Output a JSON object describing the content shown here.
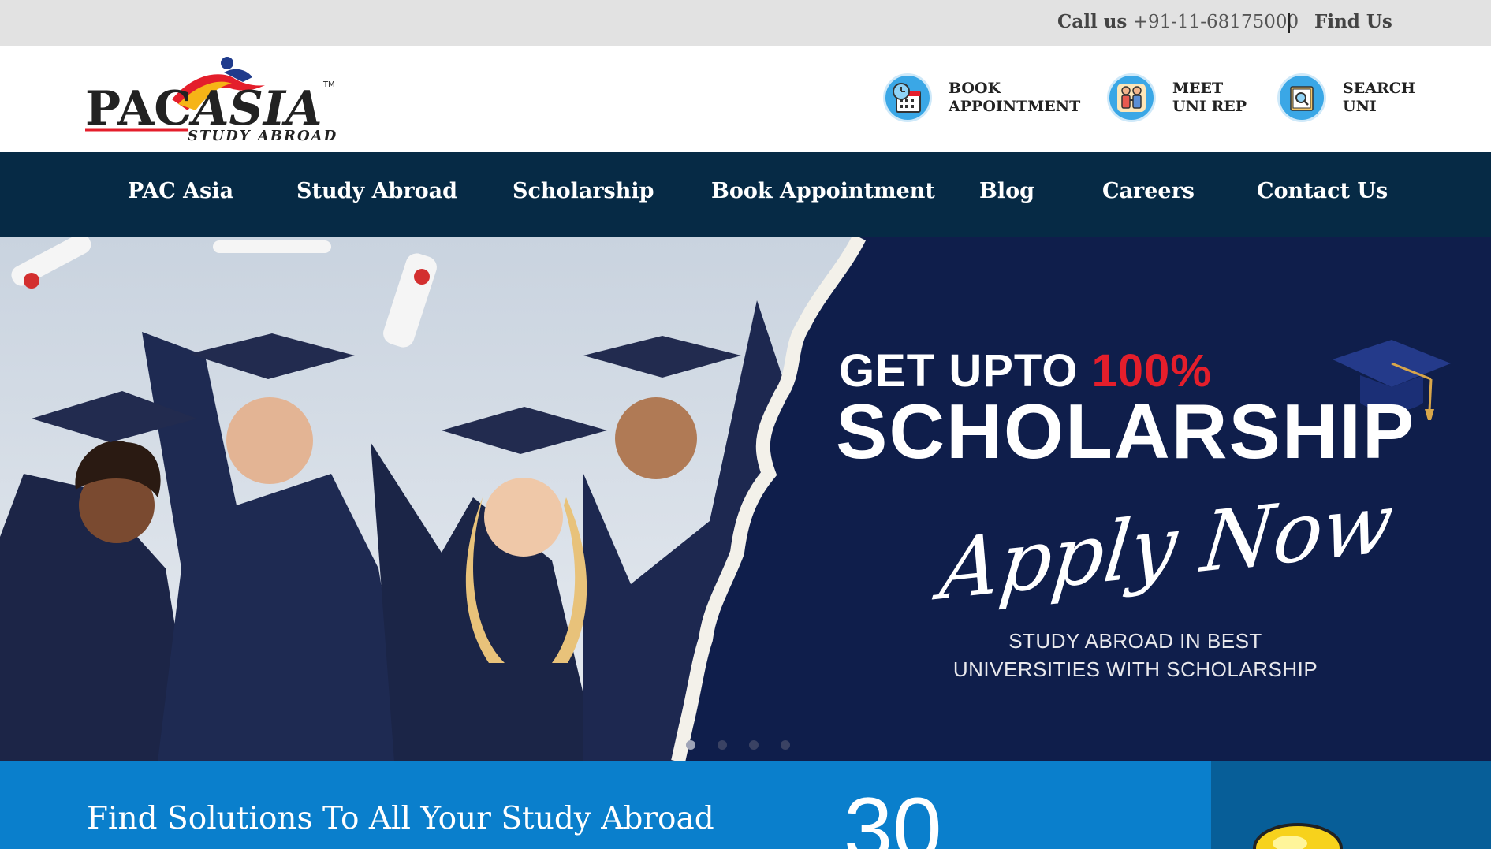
{
  "topbar": {
    "call_prefix": "Call us",
    "phone": "+91-11-68175000",
    "find_us": "Find Us"
  },
  "logo": {
    "brand": "PACASIA",
    "tagline": "STUDY ABROAD",
    "trademark": "TM"
  },
  "quick_links": [
    {
      "line1": "BOOK",
      "line2": "APPOINTMENT",
      "icon": "calendar-clock-icon"
    },
    {
      "line1": "MEET",
      "line2": "UNI REP",
      "icon": "meeting-people-icon"
    },
    {
      "line1": "SEARCH",
      "line2": "UNI",
      "icon": "search-book-icon"
    }
  ],
  "nav": {
    "items": [
      "PAC Asia",
      "Study Abroad",
      "Scholarship",
      "Book Appointment",
      "Blog",
      "Careers",
      "Contact Us"
    ]
  },
  "hero": {
    "line1_prefix": "GET UPTO",
    "line1_highlight": "100%",
    "line2": "SCHOLARSHIP",
    "script": "Apply Now",
    "sub_line1": "STUDY ABROAD IN BEST",
    "sub_line2": "UNIVERSITIES WITH SCHOLARSHIP",
    "slides": 4,
    "active_slide": 1
  },
  "bottom": {
    "heading": "Find Solutions To All Your Study Abroad",
    "counter": "30"
  },
  "colors": {
    "topbar_bg": "#e2e2e2",
    "nav_bg": "#062a45",
    "hero_bg": "#0f1e4b",
    "accent_red": "#e41e2b",
    "strip_blue": "#0a7fcc",
    "icon_blue": "#3aa7e6"
  }
}
